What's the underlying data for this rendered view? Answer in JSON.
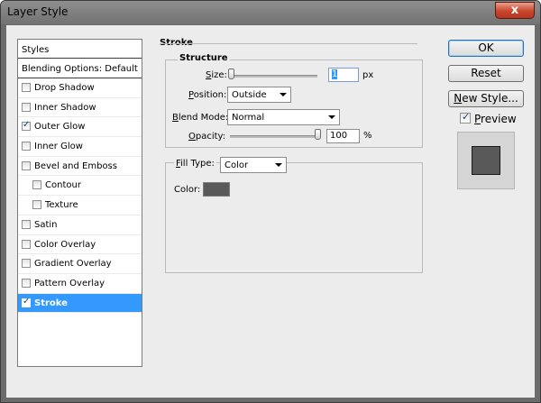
{
  "window": {
    "title": "Layer Style",
    "close_glyph": "x"
  },
  "styles": {
    "header": "Styles",
    "blending": "Blending Options: Default",
    "items": [
      {
        "label": "Drop Shadow",
        "checked": false,
        "indent": false,
        "selected": false
      },
      {
        "label": "Inner Shadow",
        "checked": false,
        "indent": false,
        "selected": false
      },
      {
        "label": "Outer Glow",
        "checked": true,
        "indent": false,
        "selected": false
      },
      {
        "label": "Inner Glow",
        "checked": false,
        "indent": false,
        "selected": false
      },
      {
        "label": "Bevel and Emboss",
        "checked": false,
        "indent": false,
        "selected": false
      },
      {
        "label": "Contour",
        "checked": false,
        "indent": true,
        "selected": false
      },
      {
        "label": "Texture",
        "checked": false,
        "indent": true,
        "selected": false
      },
      {
        "label": "Satin",
        "checked": false,
        "indent": false,
        "selected": false
      },
      {
        "label": "Color Overlay",
        "checked": false,
        "indent": false,
        "selected": false
      },
      {
        "label": "Gradient Overlay",
        "checked": false,
        "indent": false,
        "selected": false
      },
      {
        "label": "Pattern Overlay",
        "checked": false,
        "indent": false,
        "selected": false
      },
      {
        "label": "Stroke",
        "checked": true,
        "indent": false,
        "selected": true
      }
    ]
  },
  "stroke": {
    "title": "Stroke",
    "structure": {
      "title": "Structure",
      "size_label": "Size:",
      "size_value": "1",
      "size_unit": "px",
      "size_level": 0.01,
      "position_label": "Position:",
      "position_value": "Outside",
      "blend_label": "Blend Mode:",
      "blend_value": "Normal",
      "opacity_label": "Opacity:",
      "opacity_value": "100",
      "opacity_unit": "%",
      "opacity_level": 1.0
    },
    "fill": {
      "type_label": "Fill Type:",
      "type_value": "Color",
      "color_label": "Color:",
      "color_hex": "#595959"
    }
  },
  "buttons": {
    "ok": "OK",
    "reset": "Reset",
    "new_style": "New Style...",
    "preview": "Preview"
  },
  "colors": {
    "selection": "#3399ff",
    "dialog_bg": "#ececec"
  }
}
